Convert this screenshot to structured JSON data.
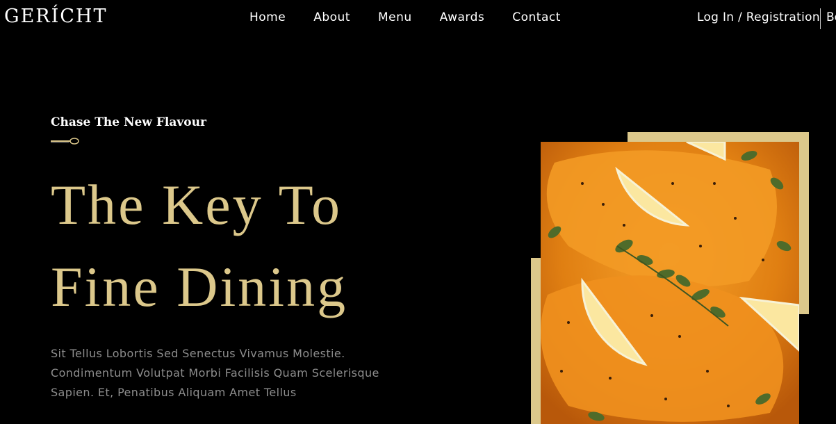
{
  "nav": {
    "logo": "GERÍCHT",
    "links": [
      {
        "label": "Home"
      },
      {
        "label": "About"
      },
      {
        "label": "Menu"
      },
      {
        "label": "Awards"
      },
      {
        "label": "Contact"
      }
    ],
    "login_label": "Log In / Registration",
    "book_label": "Bo"
  },
  "hero": {
    "subtitle": "Chase The New Flavour",
    "headline_line1": "The Key To",
    "headline_line2": "Fine Dining",
    "description": "Sit Tellus Lobortis Sed Senectus Vivamus Molestie. Condimentum Volutpat Morbi Facilisis Quam Scelerisque Sapien. Et, Penatibus Aliquam Amet Tellus"
  },
  "colors": {
    "accent": "#dcc88b",
    "background": "#000000",
    "text_muted": "#8d8d8d"
  },
  "icons": {
    "spoon": "spoon-icon"
  }
}
